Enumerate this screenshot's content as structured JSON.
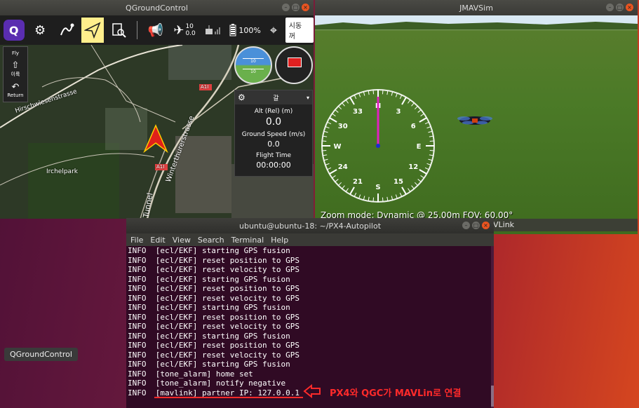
{
  "qgc": {
    "title": "QGroundControl",
    "toolbar": {
      "sat_count": "10",
      "hdop": "0.0",
      "battery": "100%",
      "flight_mode": "시동 꺼"
    },
    "fly_tools": [
      {
        "label": "Fly"
      },
      {
        "label": "이륙"
      },
      {
        "label": "Return"
      }
    ],
    "map_labels": {
      "park": "Irchelpark",
      "street1": "Hirschwiesenstrasse",
      "street2": "Winterthurerstrasse",
      "tunnel": "Tunnel",
      "road_badge": "A1I"
    },
    "attitude_marks": [
      "10",
      "10"
    ],
    "values": {
      "alt_label": "Alt (Rel) (m)",
      "alt_value": "0.0",
      "speed_label": "Ground Speed (m/s)",
      "speed_value": "0.0",
      "time_label": "Flight Time",
      "time_value": "00:00:00",
      "head_char": "갈"
    }
  },
  "jmavsim": {
    "title": "JMAVSim",
    "status": "Zoom mode: Dynamic @ 25.00m  FOV: 60.00°",
    "mavlink_strip": "VLink",
    "compass": [
      "N",
      "3",
      "6",
      "E",
      "12",
      "15",
      "S",
      "21",
      "24",
      "W",
      "30",
      "33"
    ]
  },
  "terminal": {
    "title": "ubuntu@ubuntu-18: ~/PX4-Autopilot",
    "menu": [
      "File",
      "Edit",
      "View",
      "Search",
      "Terminal",
      "Help"
    ],
    "lines": [
      "INFO  [ecl/EKF] starting GPS fusion",
      "INFO  [ecl/EKF] reset position to GPS",
      "INFO  [ecl/EKF] reset velocity to GPS",
      "INFO  [ecl/EKF] starting GPS fusion",
      "INFO  [ecl/EKF] reset position to GPS",
      "INFO  [ecl/EKF] reset velocity to GPS",
      "INFO  [ecl/EKF] starting GPS fusion",
      "INFO  [ecl/EKF] reset position to GPS",
      "INFO  [ecl/EKF] reset velocity to GPS",
      "INFO  [ecl/EKF] starting GPS fusion",
      "INFO  [ecl/EKF] reset position to GPS",
      "INFO  [ecl/EKF] reset velocity to GPS",
      "INFO  [ecl/EKF] starting GPS fusion",
      "INFO  [tone_alarm] home set",
      "INFO  [tone_alarm] notify negative",
      "INFO  [mavlink] partner IP: 127.0.0.1"
    ]
  },
  "desktop": {
    "dock_label": "QGroundControl",
    "annotation": "PX4와 QGC가 MAVLin로 연결"
  },
  "colors": {
    "accent_yellow": "#ffee8c",
    "terminal_bg": "#300a24",
    "annotation_red": "#ff2a2a",
    "compass_needle": "#e020c0"
  }
}
